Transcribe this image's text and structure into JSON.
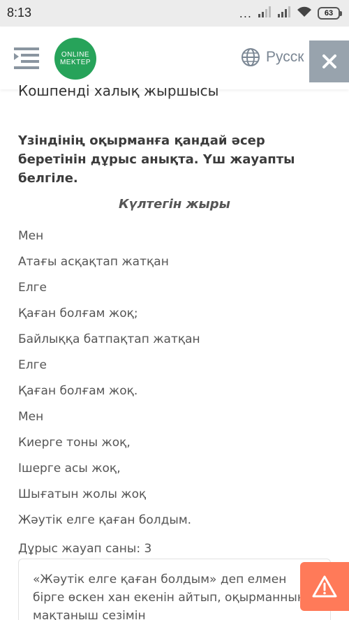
{
  "status": {
    "time": "8:13",
    "dots": "...",
    "battery": "63"
  },
  "header": {
    "logo_line1": "ONLINE",
    "logo_line2": "MEKTEP",
    "language": "Русск"
  },
  "content": {
    "cut_heading": "Кошпенді халық жыршысы",
    "question": "Үзіндінің оқырманға қандай әсер беретінін дұрыс анықта. Үш жауапты белгіле.",
    "poem_title": "Күлтегін жыры",
    "poem_lines": [
      "Мен",
      "Атағы асқақтап жатқан",
      "Елге",
      "Қаған болғам жоқ;",
      "Байлыққа батпақтап жатқан",
      "Елге",
      "Қаған болғам жоқ.",
      "Мен",
      "Киерге тоны жоқ,",
      "Ішерге асы жоқ,",
      "Шығатын жолы жоқ",
      "Жәутік елге қаған болдым."
    ],
    "answer_count": "Дұрыс жауап саны: 3",
    "answer_option_1": "«Жәутік елге қаған болдым» деп елмен бірге өскен хан екенін айтып, оқырманның мақтаныш сезімін"
  },
  "colors": {
    "logo_green": "#27a35a",
    "close_gray": "#98a3ad",
    "warning_orange": "#ff7a59",
    "menu_gray": "#8a95a0"
  }
}
